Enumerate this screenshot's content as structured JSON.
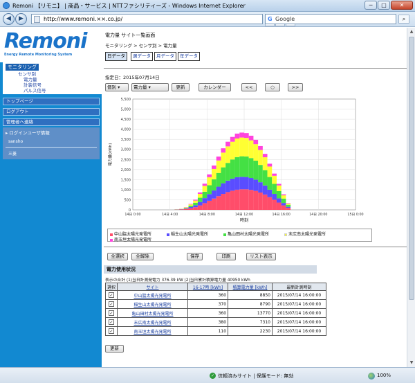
{
  "browser": {
    "title": "Remoni 【リモニ】 | 商品・サービス | NTTファシリティーズ - Windows Internet Explorer",
    "url": "http://www.remoni.××.co.jp/",
    "search_placeholder": "Google",
    "controls": {
      "minimize": "─",
      "maximize": "□",
      "close": "✕"
    },
    "status_security": "信頼済みサイト | 保護モード: 無効",
    "zoom": "100%"
  },
  "sidebar": {
    "logo": "Remoni",
    "tagline": "Energy Remote Monitoring System",
    "menu_heading": "モニタリング",
    "menu_items": [
      "センサ別",
      "電力量",
      "計装信号",
      "パルス信号"
    ],
    "links": [
      "トップページ",
      "ログアウト",
      "管理者へ連絡"
    ],
    "login_heading": "▸ ログインユーザ情報",
    "user_name": "sansho",
    "user_role": "三菱"
  },
  "main": {
    "page_title": "電力量 サイト一覧画面",
    "breadcrumb": "モニタリング > センサ別 > 電力量",
    "period_tabs": [
      "日データ",
      "週データ",
      "月データ",
      "年データ"
    ],
    "date_label": "指定日：2015年07月14日",
    "mode_select": "個別",
    "kind_select": "電力量",
    "update_label": "更新",
    "calendar_label": "カレンダー",
    "prev_label": "<<",
    "today_label": "○",
    "next_label": ">>",
    "actions": {
      "select_all": "全選択",
      "deselect_all": "全解除",
      "save": "保存",
      "print": "印刷",
      "list": "リスト表示"
    },
    "usage_heading": "電力使用状況",
    "sum_line": "表示の合計 (1)当日計測発電力 376.39 kW (2)当日累計積算電力量 40950 kWh",
    "refresh_label": "更新"
  },
  "table": {
    "headers": [
      "選択",
      "サイト",
      "16-17時 [kWh]",
      "積算電力量 [kWh]",
      "最新計測時刻"
    ],
    "rows": [
      {
        "site": "中山脇太陽光発電所",
        "hour": "360",
        "total": "8850",
        "time": "2015/07/14 16:00:00"
      },
      {
        "site": "稲生山太陽光発電所",
        "hour": "370",
        "total": "8790",
        "time": "2015/07/14 16:00:00"
      },
      {
        "site": "亀山田村太陽光発電所",
        "hour": "360",
        "total": "13770",
        "time": "2015/07/14 16:00:00"
      },
      {
        "site": "末広南太陽光発電所",
        "hour": "380",
        "total": "7310",
        "time": "2015/07/14 16:00:00"
      },
      {
        "site": "南玉垣太陽光発電所",
        "hour": "110",
        "total": "2230",
        "time": "2015/07/14 16:00:00"
      }
    ]
  },
  "chart_data": {
    "type": "bar",
    "stacked": true,
    "xlabel": "時刻",
    "ylabel": "電力量(kWh)",
    "ylim": [
      0,
      5500
    ],
    "yticks": [
      0,
      500,
      1000,
      1500,
      2000,
      2500,
      3000,
      3500,
      4000,
      4500,
      5000,
      5500
    ],
    "xticks": [
      "14日 0:00",
      "14日 4:00",
      "14日 8:00",
      "14日 12:00",
      "14日 16:00",
      "14日 20:00",
      "15日 0:00"
    ],
    "grid": true,
    "x_hours": [
      4.5,
      5,
      5.5,
      6,
      6.5,
      7,
      7.5,
      8,
      8.5,
      9,
      9.5,
      10,
      10.5,
      11,
      11.5,
      12,
      12.5,
      13,
      13.5,
      14,
      14.5,
      15,
      15.5,
      16,
      16.5
    ],
    "series": [
      {
        "name": "中山脇太陽光発電所",
        "color": "#ff4d6a",
        "values": [
          10,
          20,
          40,
          80,
          130,
          220,
          330,
          450,
          560,
          680,
          790,
          880,
          950,
          1000,
          1020,
          1020,
          990,
          940,
          860,
          760,
          630,
          500,
          360,
          220,
          100
        ]
      },
      {
        "name": "稲生山太陽光発電所",
        "color": "#5a4dff",
        "values": [
          5,
          10,
          25,
          60,
          100,
          170,
          250,
          330,
          400,
          470,
          530,
          570,
          600,
          620,
          620,
          610,
          590,
          560,
          510,
          450,
          370,
          290,
          210,
          120,
          50
        ]
      },
      {
        "name": "亀山田村太陽光発電所",
        "color": "#44e044",
        "values": [
          5,
          10,
          30,
          70,
          120,
          210,
          320,
          440,
          560,
          680,
          790,
          880,
          950,
          1000,
          1020,
          1020,
          990,
          940,
          860,
          760,
          630,
          500,
          360,
          220,
          100
        ]
      },
      {
        "name": "末広南太陽光発電所",
        "color": "#ffff33",
        "values": [
          5,
          10,
          25,
          60,
          110,
          190,
          290,
          400,
          510,
          620,
          730,
          820,
          880,
          920,
          930,
          920,
          880,
          820,
          740,
          640,
          520,
          400,
          280,
          160,
          60
        ]
      },
      {
        "name": "南玉垣太陽光発電所",
        "color": "#ff44dd",
        "values": [
          2,
          5,
          10,
          25,
          45,
          75,
          110,
          140,
          170,
          195,
          215,
          230,
          240,
          245,
          245,
          240,
          230,
          215,
          195,
          170,
          140,
          110,
          80,
          50,
          20
        ]
      }
    ]
  }
}
